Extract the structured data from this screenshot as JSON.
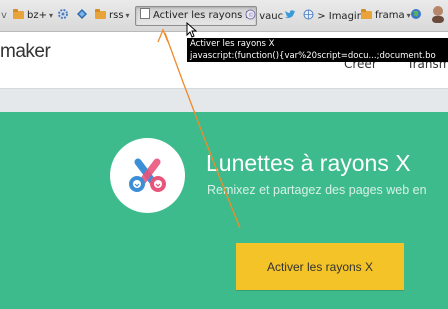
{
  "bookmarks": {
    "leading_glyph": "v",
    "bz_label": "bz+",
    "rss_label": "rss",
    "active_bookmark": "Activer les rayons X",
    "vauc_label": "vauc",
    "imagin_label": "> Imagin",
    "frama_label": "frama"
  },
  "tooltip": {
    "title": "Activer les rayons X",
    "url": "javascript:(function(){var%20script=docu...;document.bo"
  },
  "header": {
    "logo": "maker",
    "nav_create": "Créer",
    "nav_transmit": "Transm"
  },
  "hero": {
    "title": "Lunettes à rayons X",
    "subtitle": "Remixez et partagez des pages web en",
    "cta_label": "Activer les rayons X"
  },
  "colors": {
    "hero_green": "#3dbb8c",
    "cta_yellow": "#f4c327",
    "arrow_orange": "#f08a2a",
    "tooltip_bg": "#000000"
  }
}
